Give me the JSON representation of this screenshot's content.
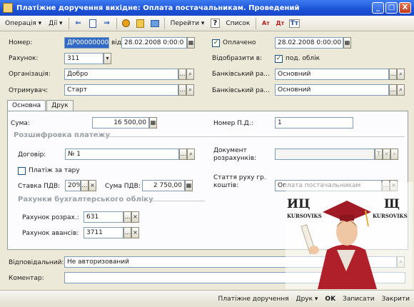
{
  "window": {
    "title": "Платіжне доручення вихідне: Оплата постачальникам. Проведений",
    "minimize": "_",
    "maximize": "□",
    "close": "X"
  },
  "toolbar": {
    "operation": "Операція ▾",
    "actions": "Дії ▾",
    "goto": "Перейти ▾",
    "help": "?",
    "list": "Список",
    "icons": [
      "back-icon",
      "doc-icon",
      "forward-icon",
      "post-icon",
      "report-icon",
      "structure-icon",
      "dt-kt-icon",
      "dt-kt-plus-icon",
      "tt-icon"
    ]
  },
  "header": {
    "number_label": "Номер:",
    "number_value": "ДР00000000",
    "from_label": "від",
    "date_value": "28.02.2008  0:00:0",
    "paid_label": "Оплачено",
    "paid_checked": true,
    "paid_date": "28.02.2008  0:00:00",
    "account_label": "Рахунок:",
    "account_value": "311",
    "reflect_label": "Відобразити в:",
    "tax_accounting_label": "под. облік",
    "tax_checked": true,
    "org_label": "Організація:",
    "org_value": "Добро",
    "bank_account1_label": "Банківський ра...",
    "bank_account1_value": "Основний",
    "recipient_label": "Отримувач:",
    "recipient_value": "Старт",
    "bank_account2_label": "Банківський ра...",
    "bank_account2_value": "Основний"
  },
  "tabs": [
    {
      "label": "Основна",
      "active": true
    },
    {
      "label": "Друк",
      "active": false
    }
  ],
  "main": {
    "sum_label": "Сума:",
    "sum_value": "16 500,00",
    "pd_number_label": "Номер П.Д.:",
    "pd_number_value": "1",
    "section_payment": "Розшифровка платежу",
    "contract_label": "Договір:",
    "contract_value": "№ 1",
    "settlement_doc_label": "Документ розрахунків:",
    "settlement_doc_value": "",
    "tare_label": "Платіж за тару",
    "tare_checked": false,
    "vat_rate_label": "Ставка ПДВ:",
    "vat_rate_value": "20%",
    "vat_sum_label": "Сума ПДВ:",
    "vat_sum_value": "2 750,00",
    "cashflow_label": "Стаття руху гр. коштів:",
    "cashflow_value": "Оплата постачальникам",
    "section_accounts": "Рахунки бухгалтерського обліку",
    "settle_account_label": "Рахунок розрах.:",
    "settle_account_value": "631",
    "advance_account_label": "Рахунок авансів:",
    "advance_account_value": "3711"
  },
  "footer": {
    "responsible_label": "Відповідальний:",
    "responsible_value": "Не авторизований",
    "comment_label": "Коментар:",
    "comment_value": ""
  },
  "statusbar": {
    "doc": "Платіжне доручення",
    "print": "Друк ▾",
    "ok": "OK",
    "save": "Записати",
    "close": "Закрити"
  },
  "stamp": {
    "left_text": "ИЦ",
    "left_sub": "KURSOVIKS",
    "right_text": "Щ",
    "right_sub": "KURSOVIKS"
  }
}
